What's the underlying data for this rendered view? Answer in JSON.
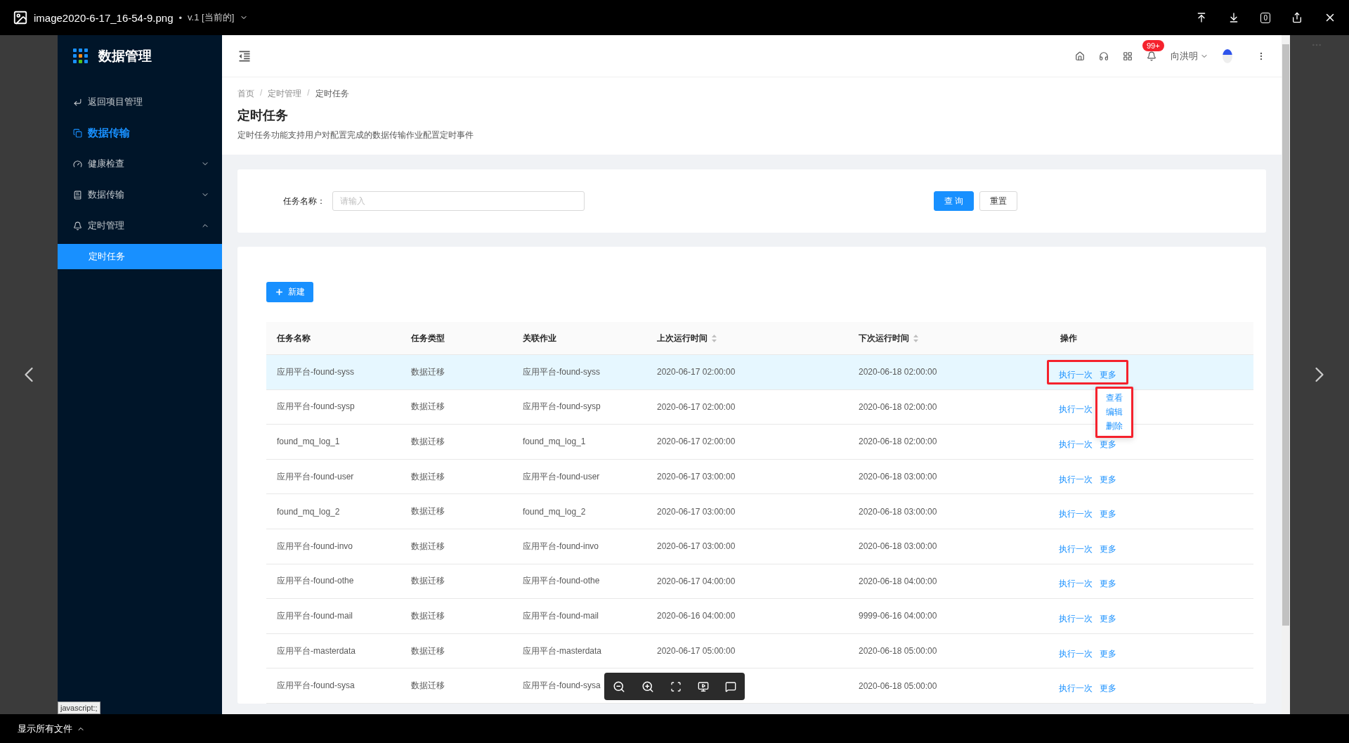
{
  "viewer": {
    "file_name": "image2020-6-17_16-54-9.png",
    "separator": "•",
    "version": "v.1 [当前的]",
    "comment_count": "0",
    "footer_label": "显示所有文件",
    "link_tooltip": "javascript:;"
  },
  "app": {
    "brand": "数据管理",
    "sidebar": [
      {
        "kind": "link",
        "label": "返回项目管理"
      },
      {
        "kind": "heading",
        "label": "数据传输"
      },
      {
        "kind": "submenu",
        "label": "健康检查",
        "expanded": false
      },
      {
        "kind": "submenu",
        "label": "数据传输",
        "expanded": false
      },
      {
        "kind": "submenu",
        "label": "定时管理",
        "expanded": true,
        "children": [
          {
            "label": "定时任务",
            "selected": true
          }
        ]
      }
    ],
    "header": {
      "notification_badge": "99+",
      "user_name": "向洪明"
    },
    "breadcrumb": [
      "首页",
      "定时管理",
      "定时任务"
    ],
    "breadcrumb_separator": "/",
    "page_title": "定时任务",
    "page_description": "定时任务功能支持用户对配置完成的数据传输作业配置定时事件",
    "search": {
      "label": "任务名称：",
      "placeholder": "请输入",
      "buttons": [
        {
          "kind": "primary",
          "label": "查 询"
        },
        {
          "kind": "default",
          "label": "重置"
        }
      ]
    },
    "table": {
      "new_button": "新建",
      "columns": [
        {
          "label": "任务名称",
          "sortable": false
        },
        {
          "label": "任务类型",
          "sortable": false
        },
        {
          "label": "关联作业",
          "sortable": false
        },
        {
          "label": "上次运行时间",
          "sortable": true
        },
        {
          "label": "下次运行时间",
          "sortable": true
        },
        {
          "label": "操作",
          "sortable": false
        }
      ],
      "rows": [
        {
          "highlighted": true,
          "cells": [
            "应用平台-found-syss",
            "数据迁移",
            "应用平台-found-syss",
            "2020-06-17 02:00:00",
            "2020-06-18 02:00:00"
          ],
          "actions": [
            "执行一次",
            "更多"
          ],
          "annotated": true,
          "menu": {
            "items": [
              "查看",
              "编辑",
              "删除"
            ],
            "annotated": true
          }
        },
        {
          "highlighted": false,
          "cells": [
            "应用平台-found-sysp",
            "数据迁移",
            "应用平台-found-sysp",
            "2020-06-17 02:00:00",
            "2020-06-18 02:00:00"
          ],
          "actions": [
            "执行一次"
          ],
          "annotated": false
        },
        {
          "highlighted": false,
          "cells": [
            "found_mq_log_1",
            "数据迁移",
            "found_mq_log_1",
            "2020-06-17 02:00:00",
            "2020-06-18 02:00:00"
          ],
          "actions": [
            "执行一次",
            "更多"
          ],
          "annotated": false
        },
        {
          "highlighted": false,
          "cells": [
            "应用平台-found-user",
            "数据迁移",
            "应用平台-found-user",
            "2020-06-17 03:00:00",
            "2020-06-18 03:00:00"
          ],
          "actions": [
            "执行一次",
            "更多"
          ],
          "annotated": false
        },
        {
          "highlighted": false,
          "cells": [
            "found_mq_log_2",
            "数据迁移",
            "found_mq_log_2",
            "2020-06-17 03:00:00",
            "2020-06-18 03:00:00"
          ],
          "actions": [
            "执行一次",
            "更多"
          ],
          "annotated": false
        },
        {
          "highlighted": false,
          "cells": [
            "应用平台-found-invo",
            "数据迁移",
            "应用平台-found-invo",
            "2020-06-17 03:00:00",
            "2020-06-18 03:00:00"
          ],
          "actions": [
            "执行一次",
            "更多"
          ],
          "annotated": false
        },
        {
          "highlighted": false,
          "cells": [
            "应用平台-found-othe",
            "数据迁移",
            "应用平台-found-othe",
            "2020-06-17 04:00:00",
            "2020-06-18 04:00:00"
          ],
          "actions": [
            "执行一次",
            "更多"
          ],
          "annotated": false
        },
        {
          "highlighted": false,
          "cells": [
            "应用平台-found-mail",
            "数据迁移",
            "应用平台-found-mail",
            "2020-06-16 04:00:00",
            "9999-06-16 04:00:00"
          ],
          "actions": [
            "执行一次",
            "更多"
          ],
          "annotated": false
        },
        {
          "highlighted": false,
          "cells": [
            "应用平台-masterdata",
            "数据迁移",
            "应用平台-masterdata",
            "2020-06-17 05:00:00",
            "2020-06-18 05:00:00"
          ],
          "actions": [
            "执行一次",
            "更多"
          ],
          "annotated": false
        },
        {
          "highlighted": false,
          "cells": [
            "应用平台-found-sysa",
            "数据迁移",
            "应用平台-found-sysa",
            null,
            "2020-06-18 05:00:00"
          ],
          "actions": [
            "执行一次",
            "更多"
          ],
          "annotated": false
        }
      ]
    }
  }
}
